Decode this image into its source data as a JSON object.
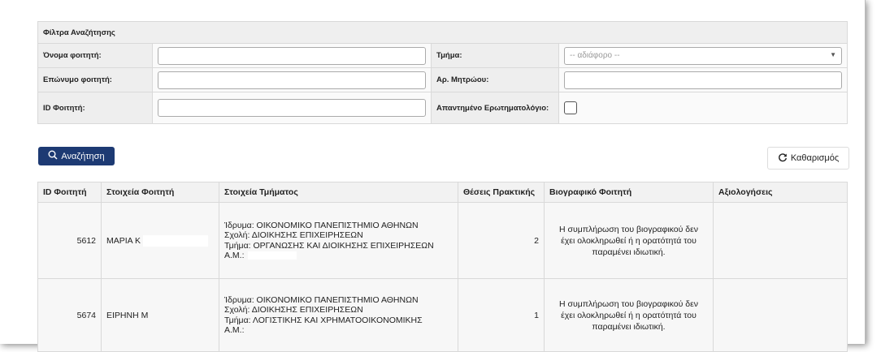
{
  "filters": {
    "title": "Φίλτρα Αναζήτησης",
    "first_name_label": "Όνομα φοιτητή:",
    "first_name_value": "",
    "last_name_label": "Επώνυμο φοιτητή:",
    "last_name_value": "",
    "student_id_label": "ID Φοιτητή:",
    "student_id_value": "",
    "department_label": "Τμήμα:",
    "department_value": "-- αδιάφορο --",
    "registry_label": "Αρ. Μητρώου:",
    "registry_value": "",
    "questionnaire_label": "Απαντημένο Ερωτηματολόγιο:",
    "questionnaire_checked": false
  },
  "actions": {
    "search_label": "Αναζήτηση",
    "clear_label": "Καθαρισμός"
  },
  "results": {
    "columns": [
      "ID Φοιτητή",
      "Στοιχεία Φοιτητή",
      "Στοιχεία Τμήματος",
      "Θέσεις Πρακτικής",
      "Βιογραφικό Φοιτητή",
      "Αξιολογήσεις"
    ],
    "rows": [
      {
        "id": "5612",
        "student": "ΜΑΡΙΑ Κ",
        "institution": "Ίδρυμα: ΟΙΚΟΝΟΜΙΚΟ ΠΑΝΕΠΙΣΤΗΜΙΟ ΑΘΗΝΩΝ",
        "school": "Σχολή: ΔΙΟΙΚΗΣΗΣ ΕΠΙΧΕΙΡΗΣΕΩΝ",
        "department": "Τμήμα: ΟΡΓΑΝΩΣΗΣ ΚΑΙ ΔΙΟΙΚΗΣΗΣ ΕΠΙΧΕΙΡΗΣΕΩΝ",
        "am": "Α.Μ.:",
        "positions": "2",
        "cv": "Η συμπλήρωση του βιογραφικού δεν έχει ολοκληρωθεί ή η ορατότητά του παραμένει ιδιωτική.",
        "evaluations": ""
      },
      {
        "id": "5674",
        "student": "ΕΙΡΗΝΗ Μ",
        "institution": "Ίδρυμα: ΟΙΚΟΝΟΜΙΚΟ ΠΑΝΕΠΙΣΤΗΜΙΟ ΑΘΗΝΩΝ",
        "school": "Σχολή: ΔΙΟΙΚΗΣΗΣ ΕΠΙΧΕΙΡΗΣΕΩΝ",
        "department": "Τμήμα: ΛΟΓΙΣΤΙΚΗΣ ΚΑΙ ΧΡΗΜΑΤΟΟΙΚΟΝΟΜΙΚΗΣ",
        "am": "Α.Μ.:",
        "positions": "1",
        "cv": "Η συμπλήρωση του βιογραφικού δεν έχει ολοκληρωθεί ή η ορατότητά του παραμένει ιδιωτική.",
        "evaluations": ""
      }
    ]
  },
  "icons": {
    "search": "search-icon",
    "refresh": "refresh-icon",
    "dropdown": "chevron-down-icon"
  },
  "colors": {
    "primary": "#1d3a73"
  }
}
